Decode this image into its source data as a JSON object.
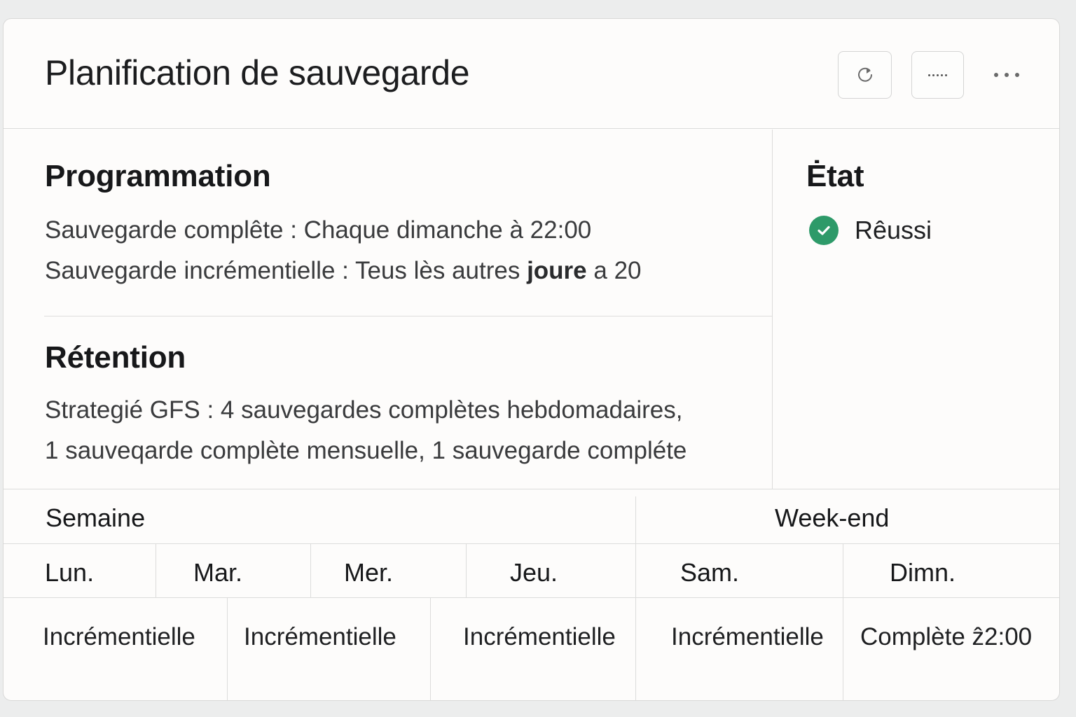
{
  "header": {
    "title": "Planification de sauvegarde"
  },
  "icons": {
    "refresh": "refresh-icon",
    "more_small": "ellipsis-icon",
    "more_large": "more-options-icon",
    "status": "check-circle-icon"
  },
  "colors": {
    "success": "#2e9a69"
  },
  "schedule": {
    "heading": "Programmation",
    "full_backup": "Sauvegarde complête : Chaque dimanche à 22:00",
    "incremental_prefix": "Sauvegarde incrémentielle : Teus lès autres ",
    "incremental_bold": "joure",
    "incremental_suffix": " a 20"
  },
  "retention": {
    "heading": "Rétention",
    "line1": "Strategié GFS : 4 sauvegardes complètes hebdomadaires,",
    "line2": "1 sauveqarde complète mensuelle, 1 sauvegarde compléte"
  },
  "status": {
    "heading": "Ėtat",
    "value": "Rêussi"
  },
  "table": {
    "groups": [
      "Semaine",
      "Week-end"
    ],
    "days": [
      "Lun.",
      "Mar.",
      "Mer.",
      "Jeu.",
      "Sam.",
      "Dimn."
    ],
    "values": [
      "Incrémentielle",
      "Incrémentielle",
      "Incrémentielle",
      "Incrémentielle",
      "Complète ẑ2:00"
    ]
  }
}
